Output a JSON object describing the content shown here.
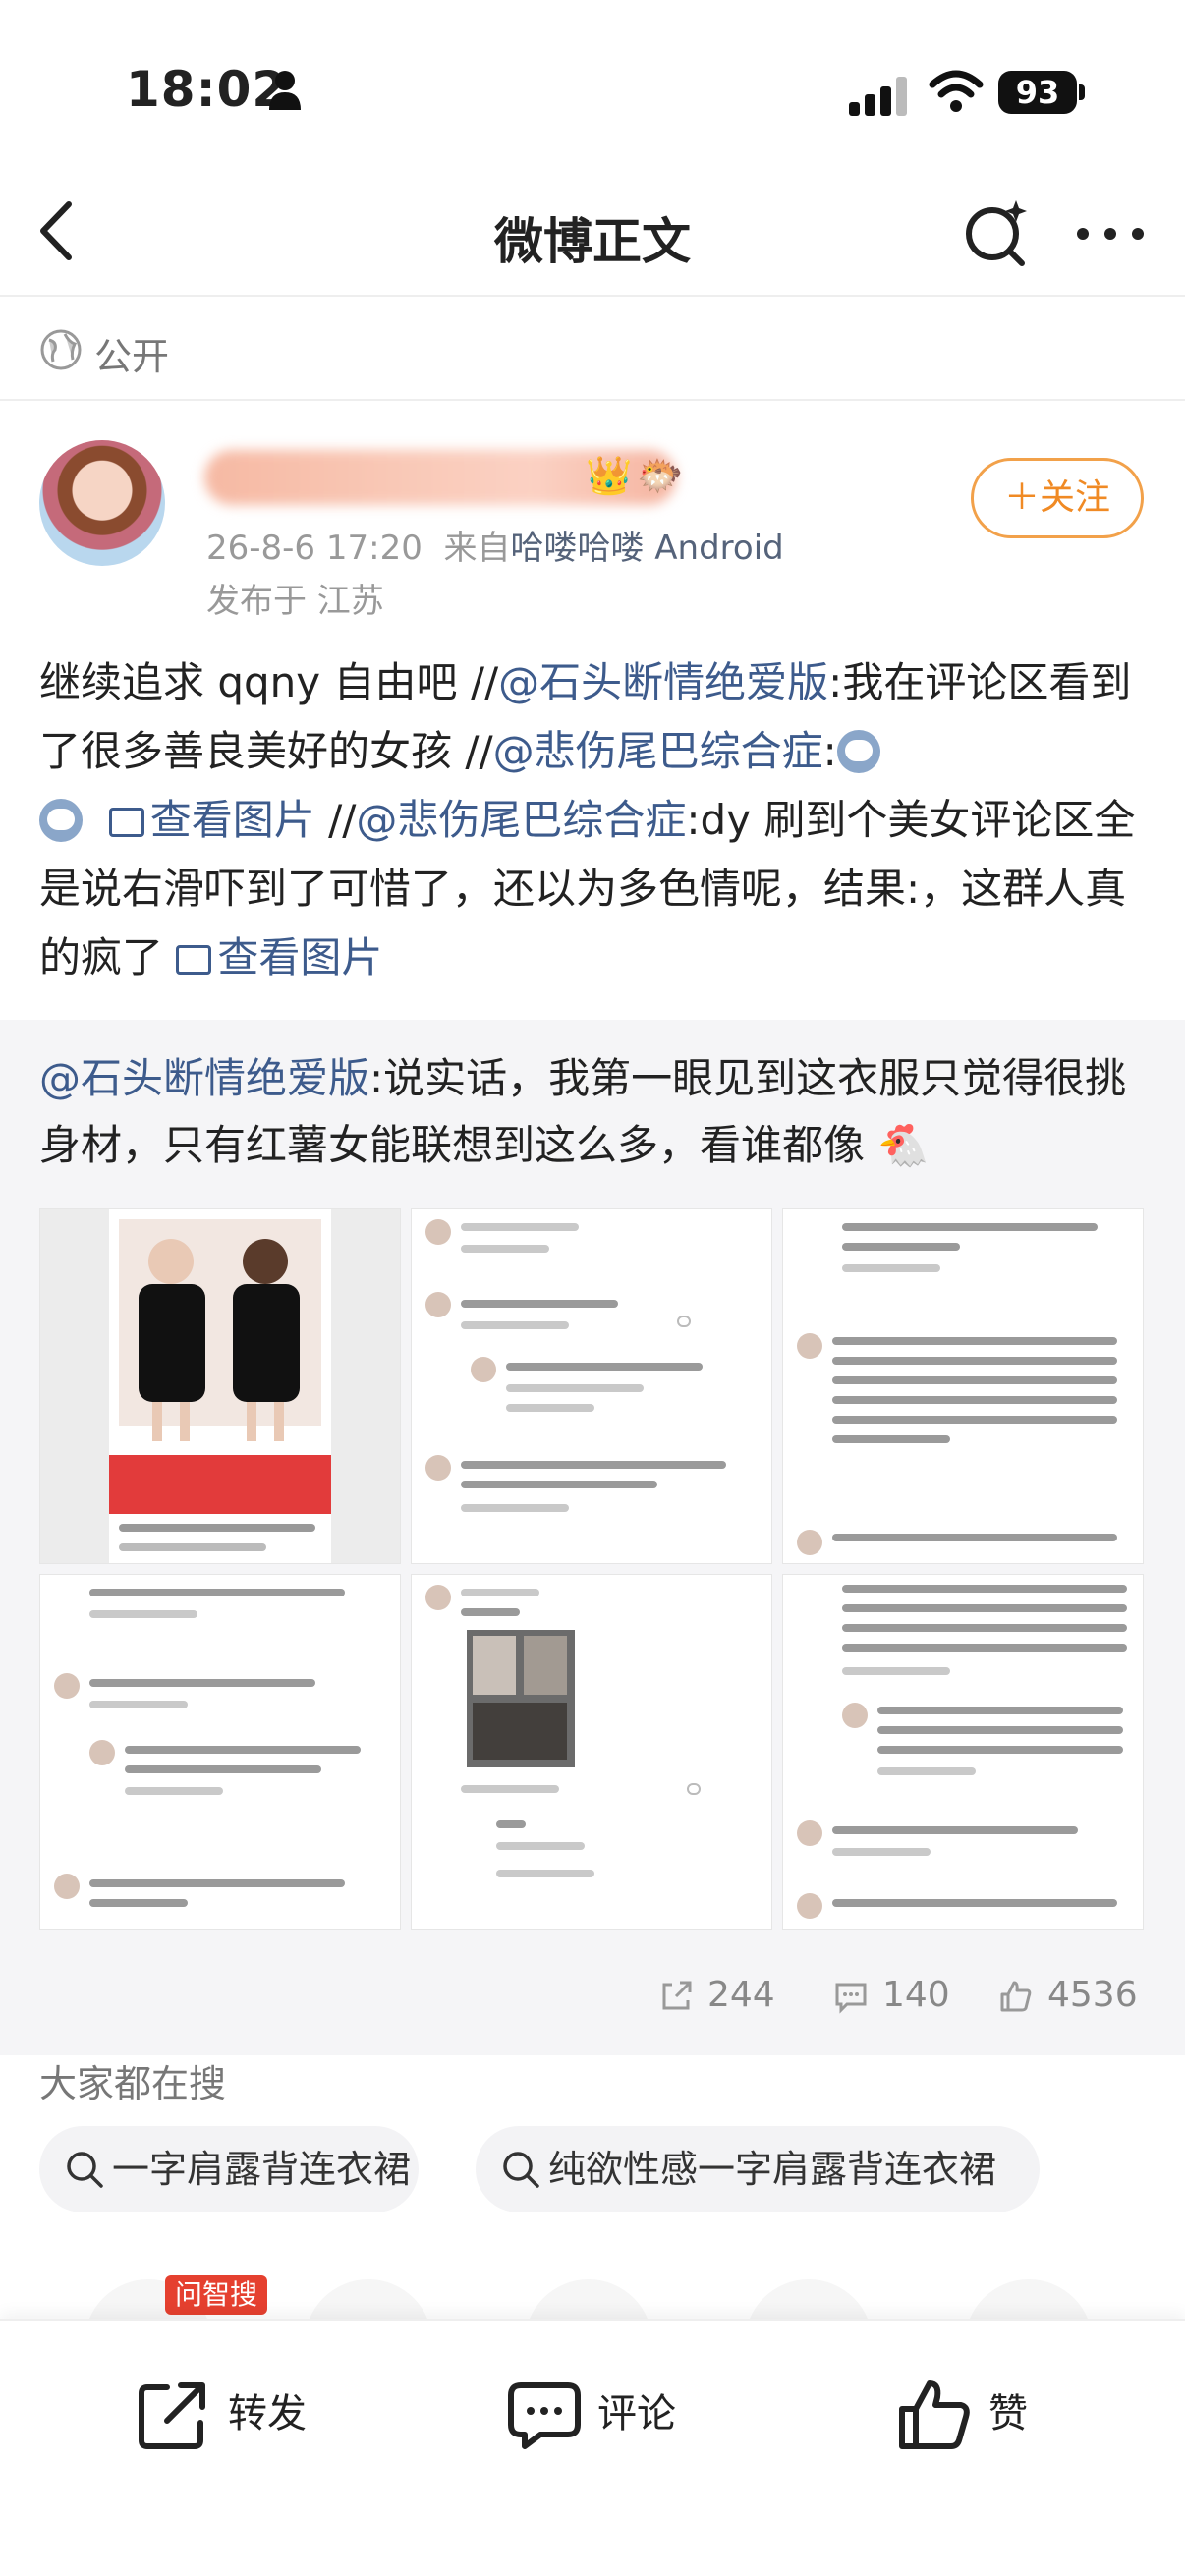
{
  "status_bar": {
    "time": "18:02",
    "battery": "93"
  },
  "nav": {
    "title": "微博正文"
  },
  "visibility": {
    "label": "公开"
  },
  "author": {
    "timestamp": "26-8-6 17:20",
    "source_prefix": "来自",
    "source": "哈喽哈喽 Android",
    "location": "发布于 江苏",
    "follow_label": "＋关注"
  },
  "post": {
    "t1": "继续追求 qqny 自由吧 //",
    "at1": "@石头断情绝爱版",
    "t2": ":我在评论区看到了很多善良美好的女孩 //",
    "at2": "@悲伤尾巴综合症",
    "t3": ":",
    "img1": "查看图片",
    "t4": " //",
    "at3": "@悲伤尾巴综合症",
    "t5": ":dy 刷到个美女评论区全是说右滑吓到了可惜了，还以为多色情呢，结果:，这群人真的疯了 ",
    "img2": "查看图片"
  },
  "retweet": {
    "at": "@石头断情绝爱版",
    "text": ":说实话，我第一眼见到这衣服只觉得很挑身材，只有红薯女能联想到这么多，看谁都像",
    "emoji": "🐔"
  },
  "stats": {
    "reposts": "244",
    "comments": "140",
    "likes": "4536"
  },
  "search": {
    "title": "大家都在搜",
    "chips": [
      "一字肩露背连衣裙",
      "纯欲性感一字肩露背连衣裙"
    ],
    "badge": "问智搜"
  },
  "bottom_bar": {
    "repost": "转发",
    "comment": "评论",
    "like": "赞"
  },
  "icons": [
    "person-icon",
    "signal-icon",
    "wifi-icon",
    "battery-icon",
    "back-icon",
    "ai-search-icon",
    "more-icon",
    "globe-icon",
    "crown-emoji",
    "fish-emoji",
    "image-icon",
    "share-icon",
    "comment-icon",
    "like-icon",
    "search-icon"
  ],
  "colors": {
    "accent": "#f08a24",
    "link": "#3d5b8c",
    "badge": "#e5402f"
  }
}
